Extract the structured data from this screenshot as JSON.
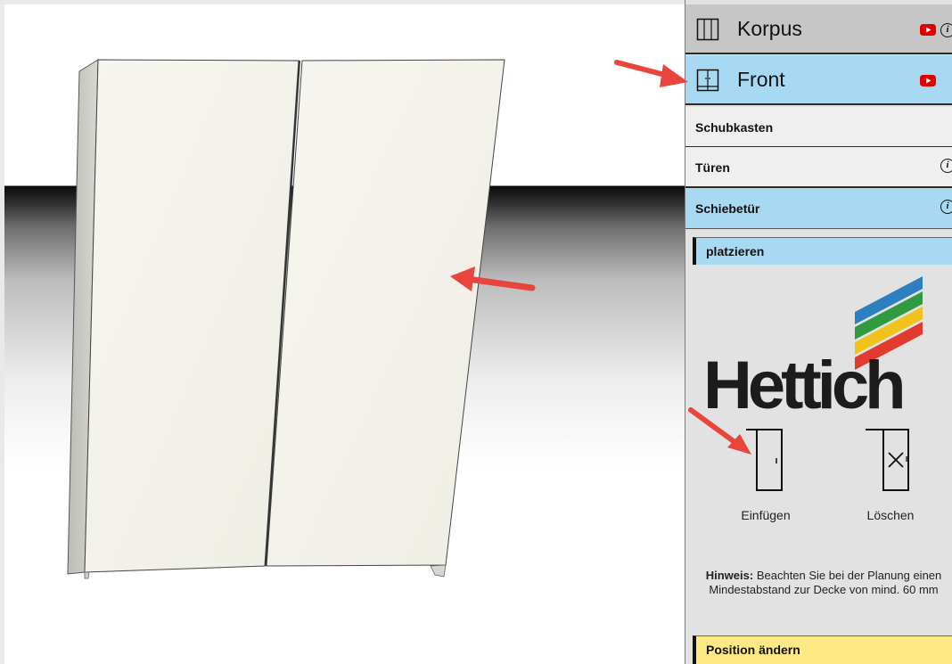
{
  "panel": {
    "korpus": {
      "label": "Korpus",
      "icon": "cabinet-icon",
      "video_icon": "youtube-icon",
      "info_icon": "info-icon"
    },
    "front": {
      "label": "Front",
      "icon": "front-panel-icon",
      "video_icon": "youtube-icon"
    },
    "subnav": [
      {
        "label": "Schubkasten"
      },
      {
        "label": "Türen",
        "info_icon": "info-icon"
      },
      {
        "label": "Schiebetür",
        "info_icon": "info-icon"
      }
    ],
    "platzieren": {
      "label": "platzieren"
    },
    "logo": {
      "brand": "Hettich",
      "stripe_colors": [
        "#2e7fc0",
        "#2f9a3f",
        "#f0c21b",
        "#e23a2e"
      ]
    },
    "actions": {
      "insert": {
        "label": "Einfügen",
        "icon": "door-insert-icon"
      },
      "delete": {
        "label": "Löschen",
        "icon": "door-delete-icon"
      }
    },
    "hint": {
      "title": "Hinweis:",
      "text": "Beachten Sie bei der Planung einen Mindestabstand zur Decke von mind. 60 mm"
    },
    "position_aendern": {
      "label": "Position ändern"
    }
  },
  "colors": {
    "active_tab": "#a8d9f3",
    "inactive_tab": "#c6c6c6",
    "highlight_yellow": "#fdea83",
    "annotation_arrow": "#e8453c",
    "youtube_red": "#e00000"
  }
}
